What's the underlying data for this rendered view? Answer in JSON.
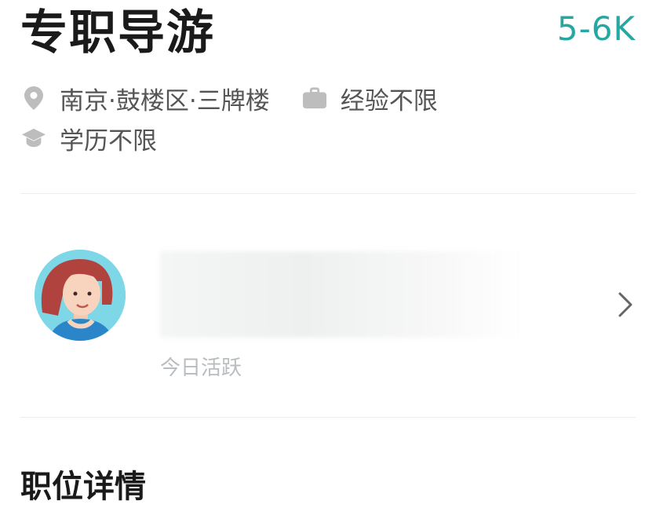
{
  "job": {
    "title": "专职导游",
    "salary": "5-6K",
    "location": "南京·鼓楼区·三牌楼",
    "experience": "经验不限",
    "education": "学历不限"
  },
  "recruiter": {
    "name": "",
    "status": "今日活跃"
  },
  "sections": {
    "details_title": "职位详情"
  },
  "icons": {
    "location": "location-pin-icon",
    "experience": "briefcase-icon",
    "education": "graduation-cap-icon",
    "chevron": "chevron-right-icon"
  },
  "colors": {
    "salary": "#27a7a2",
    "meta_icon": "#bdbdbd"
  }
}
